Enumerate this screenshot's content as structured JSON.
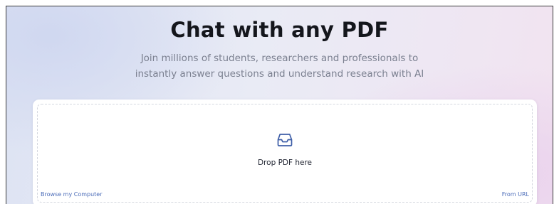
{
  "hero": {
    "title": "Chat with any PDF",
    "subtitle_line1": "Join millions of students, researchers and professionals to",
    "subtitle_line2": "instantly answer questions and understand research with AI"
  },
  "upload": {
    "icon": "inbox-icon",
    "drop_label": "Drop PDF here",
    "browse_label": "Browse my Computer",
    "url_label": "From URL"
  },
  "colors": {
    "accent": "#4a6bb8",
    "title": "#14161c",
    "subtitle": "#7b8090"
  }
}
